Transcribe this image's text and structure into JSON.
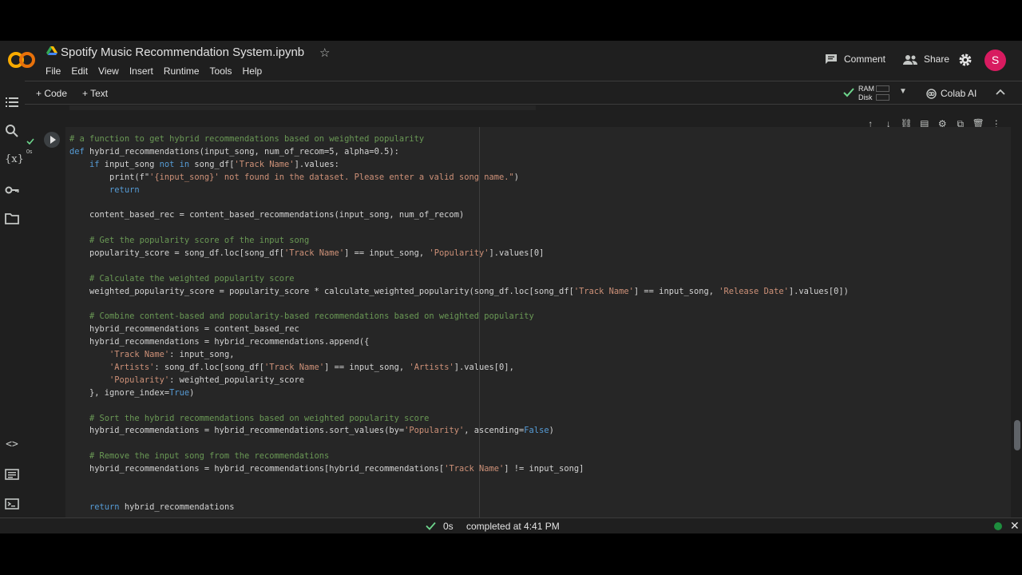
{
  "header": {
    "title": "Spotify Music Recommendation System.ipynb",
    "menu": [
      "File",
      "Edit",
      "View",
      "Insert",
      "Runtime",
      "Tools",
      "Help"
    ],
    "comment_label": "Comment",
    "share_label": "Share",
    "avatar_letter": "S",
    "avatar_color": "#d81b60"
  },
  "toolbar": {
    "add_code": "+ Code",
    "add_text": "+ Text",
    "ram_label": "RAM",
    "disk_label": "Disk",
    "colab_ai": "Colab AI"
  },
  "cell": {
    "exec_time": "0s",
    "code_lines": [
      [
        [
          "cm",
          "# a function to get hybrid recommendations based on weighted popularity"
        ]
      ],
      [
        [
          "kw",
          "def"
        ],
        [
          "tx",
          " hybrid_recommendations(input_song, num_of_recom=5, alpha=0.5):"
        ]
      ],
      [
        [
          "tx",
          "    "
        ],
        [
          "kw",
          "if"
        ],
        [
          "tx",
          " input_song "
        ],
        [
          "kw",
          "not in"
        ],
        [
          "tx",
          " song_df["
        ],
        [
          "st",
          "'Track Name'"
        ],
        [
          "tx",
          "].values:"
        ]
      ],
      [
        [
          "tx",
          "        print(f\""
        ],
        [
          "st",
          "'{input_song}' not found in the dataset. Please enter a valid song name.\""
        ],
        [
          "tx",
          ")"
        ]
      ],
      [
        [
          "tx",
          "        "
        ],
        [
          "kw",
          "return"
        ]
      ],
      [
        [
          "tx",
          ""
        ]
      ],
      [
        [
          "tx",
          "    content_based_rec = content_based_recommendations(input_song, num_of_recom)"
        ]
      ],
      [
        [
          "tx",
          ""
        ]
      ],
      [
        [
          "tx",
          "    "
        ],
        [
          "cm",
          "# Get the popularity score of the input song"
        ]
      ],
      [
        [
          "tx",
          "    popularity_score = song_df.loc[song_df["
        ],
        [
          "st",
          "'Track Name'"
        ],
        [
          "tx",
          "] == input_song, "
        ],
        [
          "st",
          "'Popularity'"
        ],
        [
          "tx",
          "].values[0]"
        ]
      ],
      [
        [
          "tx",
          ""
        ]
      ],
      [
        [
          "tx",
          "    "
        ],
        [
          "cm",
          "# Calculate the weighted popularity score"
        ]
      ],
      [
        [
          "tx",
          "    weighted_popularity_score = popularity_score * calculate_weighted_popularity(song_df.loc[song_df["
        ],
        [
          "st",
          "'Track Name'"
        ],
        [
          "tx",
          "] == input_song, "
        ],
        [
          "st",
          "'Release Date'"
        ],
        [
          "tx",
          "].values[0])"
        ]
      ],
      [
        [
          "tx",
          ""
        ]
      ],
      [
        [
          "tx",
          "    "
        ],
        [
          "cm",
          "# Combine content-based and popularity-based recommendations based on weighted popularity"
        ]
      ],
      [
        [
          "tx",
          "    hybrid_recommendations = content_based_rec"
        ]
      ],
      [
        [
          "tx",
          "    hybrid_recommendations = hybrid_recommendations.append({"
        ]
      ],
      [
        [
          "tx",
          "        "
        ],
        [
          "st",
          "'Track Name'"
        ],
        [
          "tx",
          ": input_song,"
        ]
      ],
      [
        [
          "tx",
          "        "
        ],
        [
          "st",
          "'Artists'"
        ],
        [
          "tx",
          ": song_df.loc[song_df["
        ],
        [
          "st",
          "'Track Name'"
        ],
        [
          "tx",
          "] == input_song, "
        ],
        [
          "st",
          "'Artists'"
        ],
        [
          "tx",
          "].values[0],"
        ]
      ],
      [
        [
          "tx",
          "        "
        ],
        [
          "st",
          "'Popularity'"
        ],
        [
          "tx",
          ": weighted_popularity_score"
        ]
      ],
      [
        [
          "tx",
          "    }, ignore_index="
        ],
        [
          "bl",
          "True"
        ],
        [
          "tx",
          ")"
        ]
      ],
      [
        [
          "tx",
          ""
        ]
      ],
      [
        [
          "tx",
          "    "
        ],
        [
          "cm",
          "# Sort the hybrid recommendations based on weighted popularity score"
        ]
      ],
      [
        [
          "tx",
          "    hybrid_recommendations = hybrid_recommendations.sort_values(by="
        ],
        [
          "st",
          "'Popularity'"
        ],
        [
          "tx",
          ", ascending="
        ],
        [
          "bl",
          "False"
        ],
        [
          "tx",
          ")"
        ]
      ],
      [
        [
          "tx",
          ""
        ]
      ],
      [
        [
          "tx",
          "    "
        ],
        [
          "cm",
          "# Remove the input song from the recommendations"
        ]
      ],
      [
        [
          "tx",
          "    hybrid_recommendations = hybrid_recommendations[hybrid_recommendations["
        ],
        [
          "st",
          "'Track Name'"
        ],
        [
          "tx",
          "] != input_song]"
        ]
      ],
      [
        [
          "tx",
          ""
        ]
      ],
      [
        [
          "tx",
          ""
        ]
      ],
      [
        [
          "tx",
          "    "
        ],
        [
          "kw",
          "return"
        ],
        [
          "tx",
          " hybrid_recommendations"
        ]
      ]
    ]
  },
  "status": {
    "time": "0s",
    "text": "completed at 4:41 PM"
  },
  "colors": {
    "accent_green": "#1e8e3e",
    "check_green": "#6dd58c"
  }
}
